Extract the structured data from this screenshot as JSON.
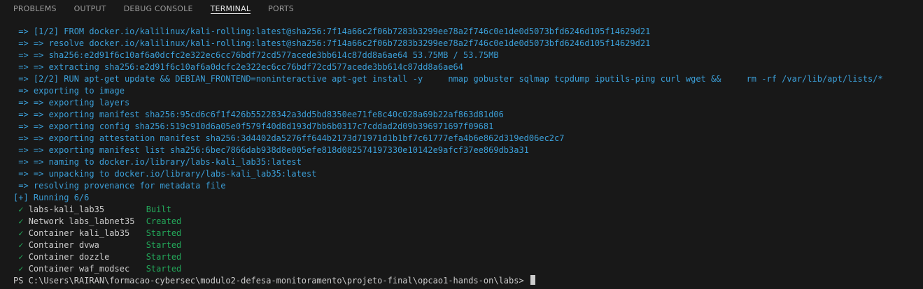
{
  "tabs": [
    "PROBLEMS",
    "OUTPUT",
    "DEBUG CONSOLE",
    "TERMINAL",
    "PORTS"
  ],
  "active_tab": "TERMINAL",
  "build_lines": [
    " => [1/2] FROM docker.io/kalilinux/kali-rolling:latest@sha256:7f14a66c2f06b7283b3299ee78a2f746c0e1de0d5073bfd6246d105f14629d21",
    " => => resolve docker.io/kalilinux/kali-rolling:latest@sha256:7f14a66c2f06b7283b3299ee78a2f746c0e1de0d5073bfd6246d105f14629d21",
    " => => sha256:e2d91f6c10af6a0dcfc2e322ec6cc76bdf72cd577acede3bb614c87dd8a6ae64 53.75MB / 53.75MB",
    " => => extracting sha256:e2d91f6c10af6a0dcfc2e322ec6cc76bdf72cd577acede3bb614c87dd8a6ae64",
    " => [2/2] RUN apt-get update && DEBIAN_FRONTEND=noninteractive apt-get install -y     nmap gobuster sqlmap tcpdump iputils-ping curl wget &&     rm -rf /var/lib/apt/lists/*",
    " => exporting to image",
    " => => exporting layers",
    " => => exporting manifest sha256:95cd6c6f1f426b55228342a3dd5bd8350ee71fe8c40c028a69b22af863d81d06",
    " => => exporting config sha256:519c910d6a05e0f579f40d8d193d7bb6b0317c7cddad2d09b396971697f09681",
    " => => exporting attestation manifest sha256:3d4402da5276ff644b2173d71971d1b1bf7c61777efa4b6e862d319ed06ec2c7",
    " => => exporting manifest list sha256:6bec7866dab938d8e005efe818d082574197330e10142e9afcf37ee869db3a31",
    " => => naming to docker.io/library/labs-kali_lab35:latest",
    " => => unpacking to docker.io/library/labs-kali_lab35:latest",
    " => resolving provenance for metadata file"
  ],
  "running_line": "[+] Running 6/6",
  "check_mark": "✓",
  "services": [
    {
      "name": "labs-kali_lab35",
      "status": "Built"
    },
    {
      "name": "Network labs_labnet35",
      "status": "Created"
    },
    {
      "name": "Container kali_lab35",
      "status": "Started"
    },
    {
      "name": "Container dvwa",
      "status": "Started"
    },
    {
      "name": "Container dozzle",
      "status": "Started"
    },
    {
      "name": "Container waf_modsec",
      "status": "Started"
    }
  ],
  "prompt": "PS C:\\Users\\RAIRAN\\formacao-cybersec\\modulo2-defesa-monitoramento\\projeto-final\\opcao1-hands-on\\labs>",
  "colors": {
    "background": "#181818",
    "log_blue": "#3b9fd8",
    "success_green": "#23a85a",
    "text": "#cccccc",
    "active_tab": "#e7e7e7",
    "inactive_tab": "#9d9d9d"
  }
}
